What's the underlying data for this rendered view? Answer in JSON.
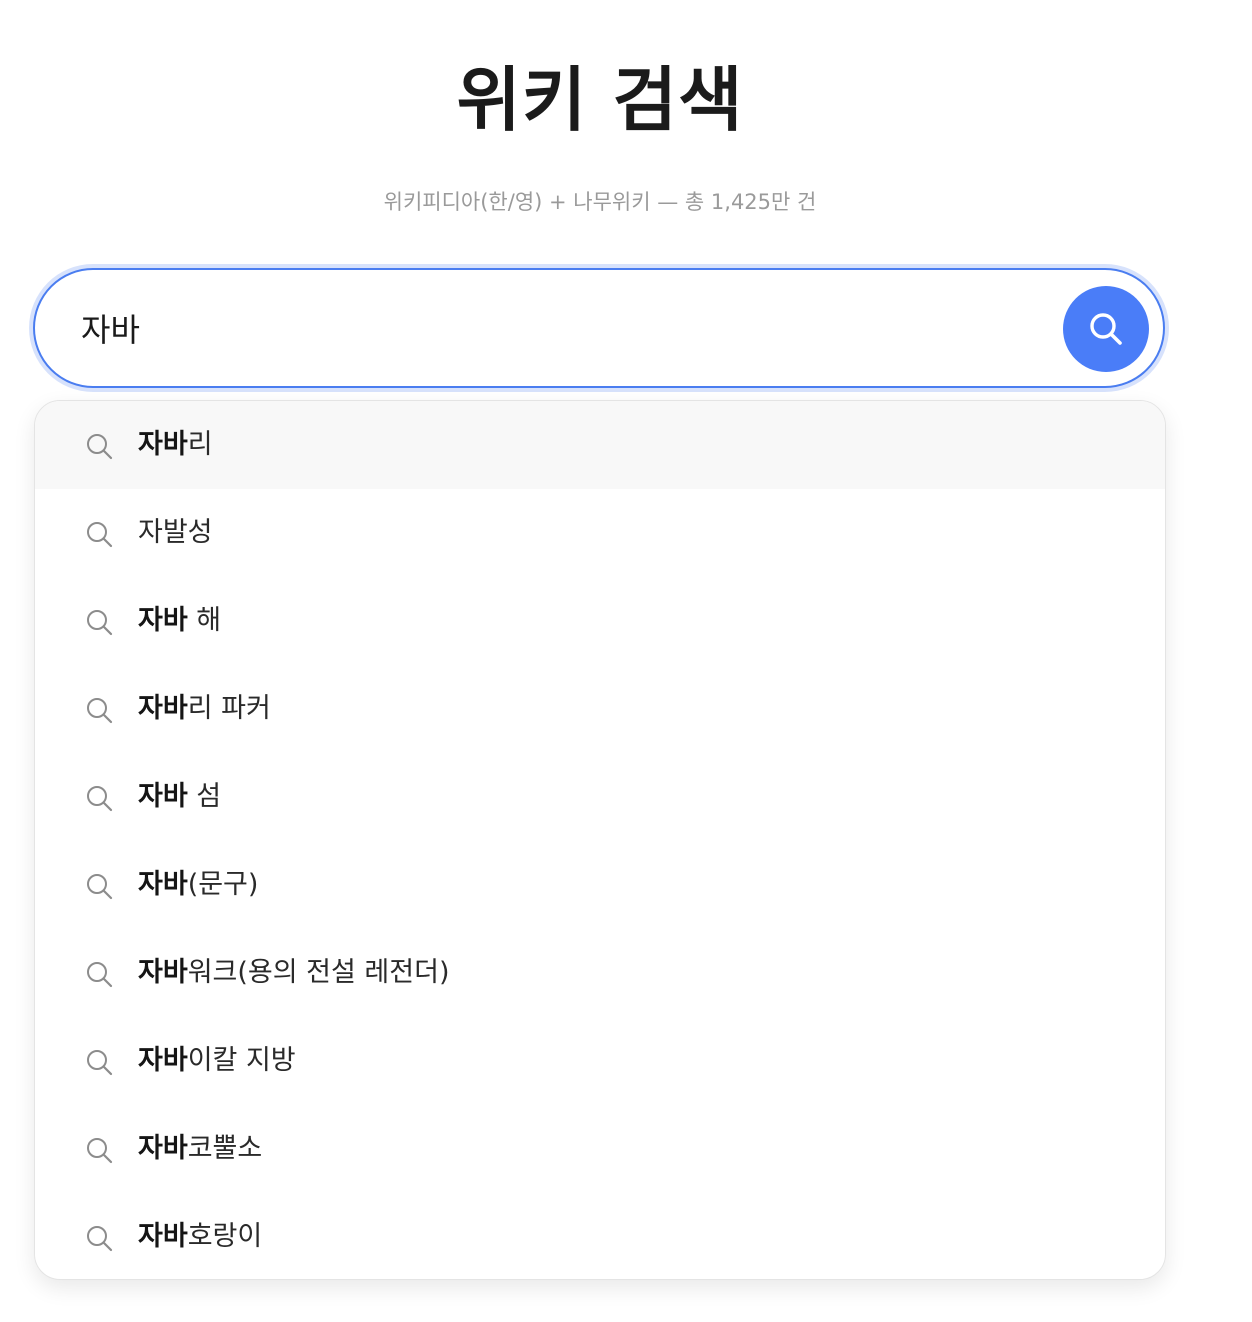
{
  "header": {
    "title": "위키 검색",
    "subtitle": "위키피디아(한/영) + 나무위키 — 총 1,425만 건"
  },
  "search": {
    "value": "자바",
    "button_icon": "search-icon"
  },
  "suggestions": [
    {
      "match": "자바",
      "rest": "리",
      "active": true
    },
    {
      "match": "",
      "rest": "자발성",
      "active": false
    },
    {
      "match": "자바",
      "rest": " 해",
      "active": false
    },
    {
      "match": "자바",
      "rest": "리 파커",
      "active": false
    },
    {
      "match": "자바",
      "rest": " 섬",
      "active": false
    },
    {
      "match": "자바",
      "rest": "(문구)",
      "active": false
    },
    {
      "match": "자바",
      "rest": "워크(용의 전설 레전더)",
      "active": false
    },
    {
      "match": "자바",
      "rest": "이칼 지방",
      "active": false
    },
    {
      "match": "자바",
      "rest": "코뿔소",
      "active": false
    },
    {
      "match": "자바",
      "rest": "호랑이",
      "active": false
    }
  ],
  "colors": {
    "accent": "#4a7df8",
    "subtitle": "#9a9a9a",
    "active_row": "#f8f8f8"
  }
}
